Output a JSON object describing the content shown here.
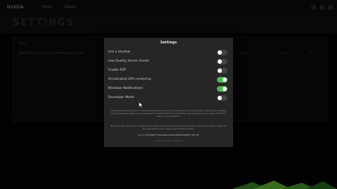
{
  "app": {
    "brand": "NVIDIA"
  },
  "nav": [
    "Home",
    "Library"
  ],
  "header": {
    "title": "SETTINGS"
  },
  "background_table": {
    "header": "Name",
    "row_text": "Availability of the new unreleased game build",
    "cells": [
      "Status",
      "Date",
      "Size"
    ]
  },
  "dialog": {
    "title": "Settings",
    "options": [
      {
        "label": "Use a shadow",
        "enabled": false
      },
      {
        "label": "Low Quality Server Assets",
        "enabled": false
      },
      {
        "label": "Enable P2P",
        "enabled": false
      },
      {
        "label": "Accelerated GPU rendering",
        "enabled": true
      },
      {
        "label": "Windows Notifications",
        "enabled": true
      },
      {
        "label": "Developer Mode",
        "enabled": false
      }
    ],
    "description_1": "These settings allow you to customise the client to your own preferences. Some options may require a restart of the application before they take effect. Enabling P2P will allow faster downloads by sharing data with other users on your network.",
    "description_2": "By using this software you agree to the terms of service and privacy policy. Data collected is used to improve the application and is never sold to third parties.",
    "version": "v1.3.7df1b6ec74aeaa6b1b04a6d3bd0b6479ecc6",
    "copyright": "© 2023 All rights reserved"
  },
  "colors": {
    "toggle_on": "#4fb84f",
    "toggle_off": "#444444",
    "dialog_bg": "#262626"
  }
}
